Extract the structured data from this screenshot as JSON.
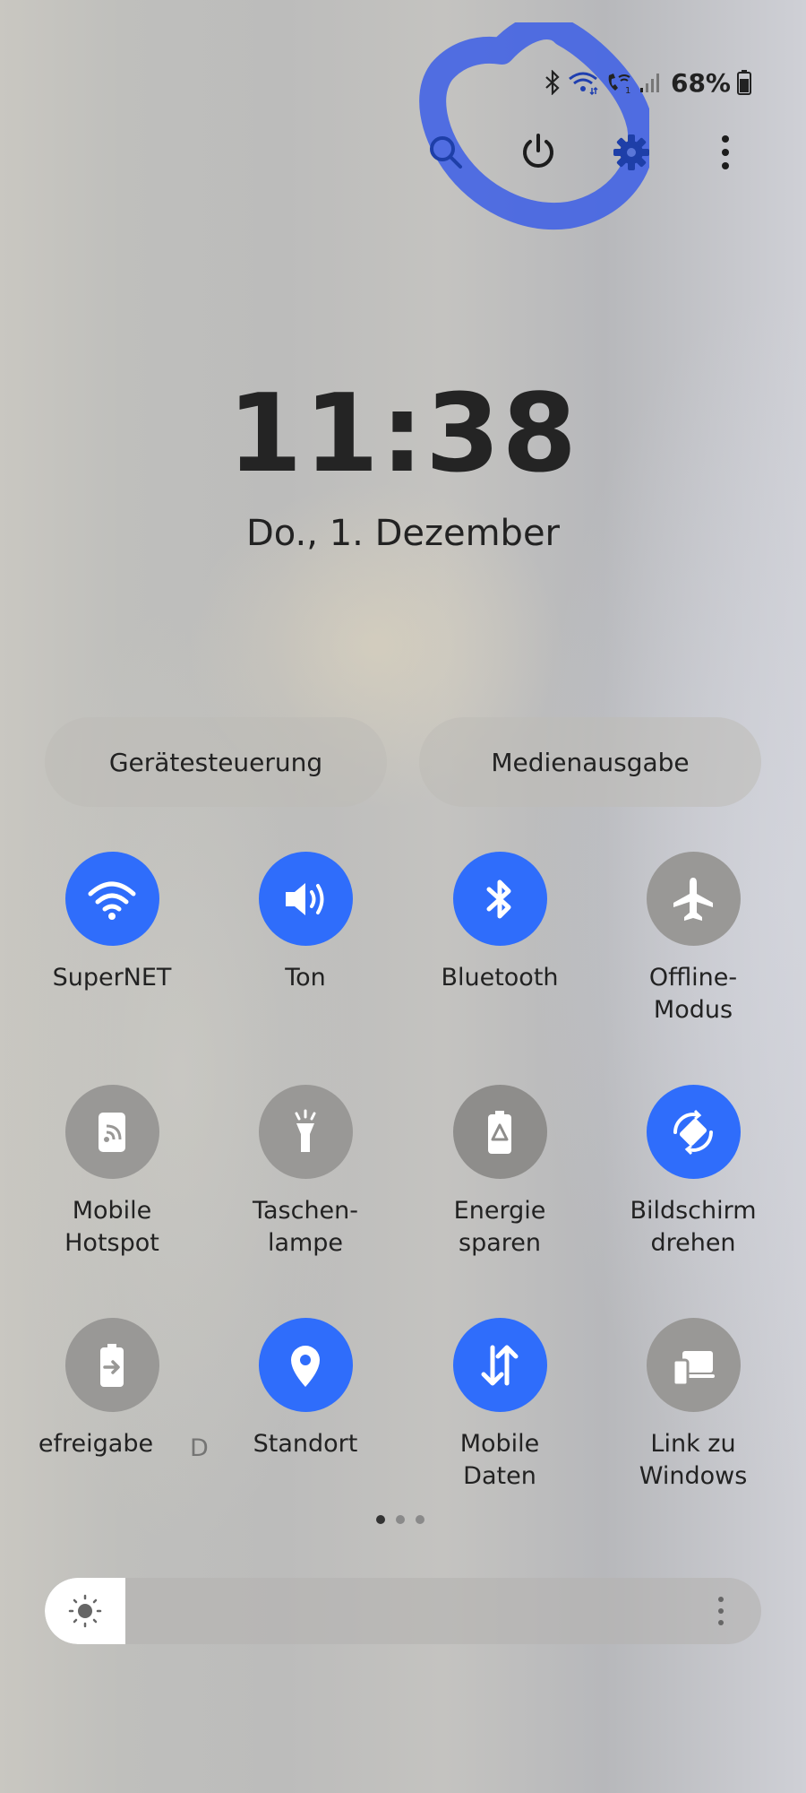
{
  "status_bar": {
    "battery_percent": "68%",
    "icons": [
      "bluetooth-icon",
      "wifi-icon",
      "wifi-calling-icon",
      "signal-icon",
      "battery-icon"
    ]
  },
  "toolbar": {
    "icons": [
      "search-icon",
      "power-icon",
      "settings-gear-icon",
      "more-vertical-icon"
    ],
    "accent_color": "#1e3fa8"
  },
  "clock": {
    "time": "11:38",
    "date": "Do., 1. Dezember"
  },
  "pills": {
    "device_control": "Gerätesteuerung",
    "media_output": "Medienausgabe"
  },
  "tiles": [
    {
      "label": "SuperNET",
      "icon": "wifi-icon",
      "active": true
    },
    {
      "label": "Ton",
      "icon": "sound-icon",
      "active": true
    },
    {
      "label": "Bluetooth",
      "icon": "bluetooth-icon",
      "active": true
    },
    {
      "label": "Offline-\nModus",
      "icon": "airplane-icon",
      "active": false
    },
    {
      "label": "Mobile\nHotspot",
      "icon": "hotspot-icon",
      "active": false
    },
    {
      "label": "Taschen-\nlampe",
      "icon": "flashlight-icon",
      "active": false
    },
    {
      "label": "Energie\nsparen",
      "icon": "power-saving-icon",
      "active": false
    },
    {
      "label": "Bildschirm\ndrehen",
      "icon": "auto-rotate-icon",
      "active": true
    },
    {
      "label": "efreigabe",
      "icon": "power-share-icon",
      "active": false
    },
    {
      "label": "Standort",
      "icon": "location-icon",
      "active": true
    },
    {
      "label": "Mobile\nDaten",
      "icon": "mobile-data-icon",
      "active": true
    },
    {
      "label": "Link zu\nWindows",
      "icon": "link-to-windows-icon",
      "active": false
    }
  ],
  "partial_label": "D",
  "pagination": {
    "pages": 3,
    "current": 1
  },
  "brightness": {
    "level": 0.09,
    "icon": "sun-icon"
  },
  "colors": {
    "active_tile": "#2f6dfb",
    "inactive_tile": "#999896",
    "annotation_scribble": "#3c5ee6"
  }
}
